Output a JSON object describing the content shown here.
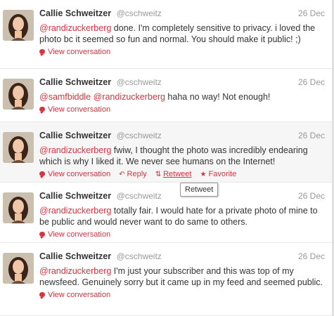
{
  "tweets": [
    {
      "fullname": "Callie Schweitzer",
      "username": "@cschweitz",
      "time": "26 Dec",
      "mentions": [
        "@randizuckerberg"
      ],
      "text": " done. I'm completely sensitive to privacy. i loved the photo bc it seemed so fun and normal. You should make it public! ;)",
      "view_conversation": "View conversation"
    },
    {
      "fullname": "Callie Schweitzer",
      "username": "@cschweitz",
      "time": "26 Dec",
      "mentions": [
        "@samfbiddle",
        "@randizuckerberg"
      ],
      "text": " haha no way! Not enough!",
      "view_conversation": "View conversation"
    },
    {
      "fullname": "Callie Schweitzer",
      "username": "@cschweitz",
      "time": "26 Dec",
      "mentions": [
        "@randizuckerberg"
      ],
      "text": " fwiw, I thought the photo was incredibly endearing which is why I liked it. We never see humans on the Internet!",
      "view_conversation": "View conversation",
      "reply": "Reply",
      "retweet": "Retweet",
      "favorite": "Favorite"
    },
    {
      "fullname": "Callie Schweitzer",
      "username": "@cschweitz",
      "time": "26 Dec",
      "mentions": [
        "@randizuckerberg"
      ],
      "text": " totally fair. I would hate for a private photo of mine to be public and would never want to do same to others.",
      "view_conversation": "View conversation"
    },
    {
      "fullname": "Callie Schweitzer",
      "username": "@cschweitz",
      "time": "26 Dec",
      "mentions": [
        "@randizuckerberg"
      ],
      "text": " I'm just your subscriber and this was top of my newsfeed. Genuinely sorry but it came up in my feed and seemed public.",
      "view_conversation": "View conversation"
    }
  ],
  "tooltip": {
    "label": "Retweet"
  },
  "colors": {
    "accent": "#d9333f",
    "muted": "#999999",
    "text": "#333333"
  }
}
